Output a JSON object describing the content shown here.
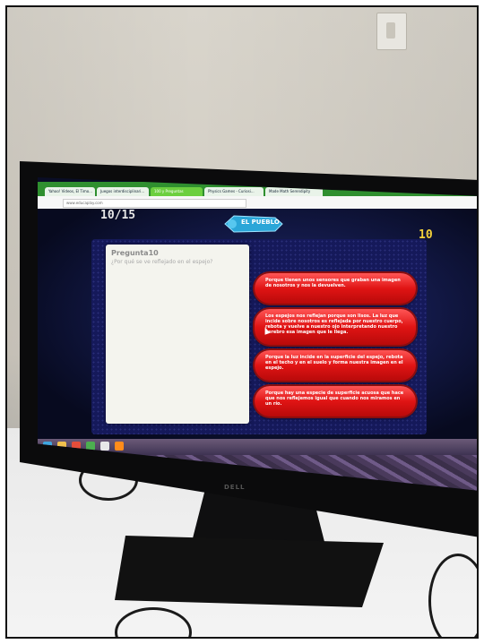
{
  "browser": {
    "tabs": [
      "Yahoo! Videos, El Timo...",
      "Juegos interdisciplinari...",
      "100 y Preguntas",
      "Physics Games - Curiosi...",
      "Made Math Serendipity"
    ],
    "url": "www.educaplay.com"
  },
  "game": {
    "counter": "10/15",
    "score": "10",
    "logo_label": "EL PUEBLO",
    "question_title": "Pregunta10",
    "question_text": "¿Por qué se ve reflejado en el espejo?",
    "answers": [
      "Porque tienen unos sensores que graban una imagen de nosotros y nos la devuelven.",
      "Los espejos nos reflejan porque son lisos. La luz que incide sobre nosotros es reflejada por nuestro cuerpo, rebota y vuelve a nuestro ojo interpretando nuestro cerebro esa imagen que le llega.",
      "Porque la luz incide en la superficie del espejo, rebota en el techo y en el suelo y forma nuestra imagen en el espejo.",
      "Porque hay una especie de superficie acuosa que hace que nos reflejemos igual que cuando nos miramos en un río."
    ]
  },
  "monitor": {
    "brand": "DELL"
  },
  "colors": {
    "answer_red": "#e01414",
    "score_yellow": "#f4d23a",
    "tab_green": "#2f8f2f"
  }
}
